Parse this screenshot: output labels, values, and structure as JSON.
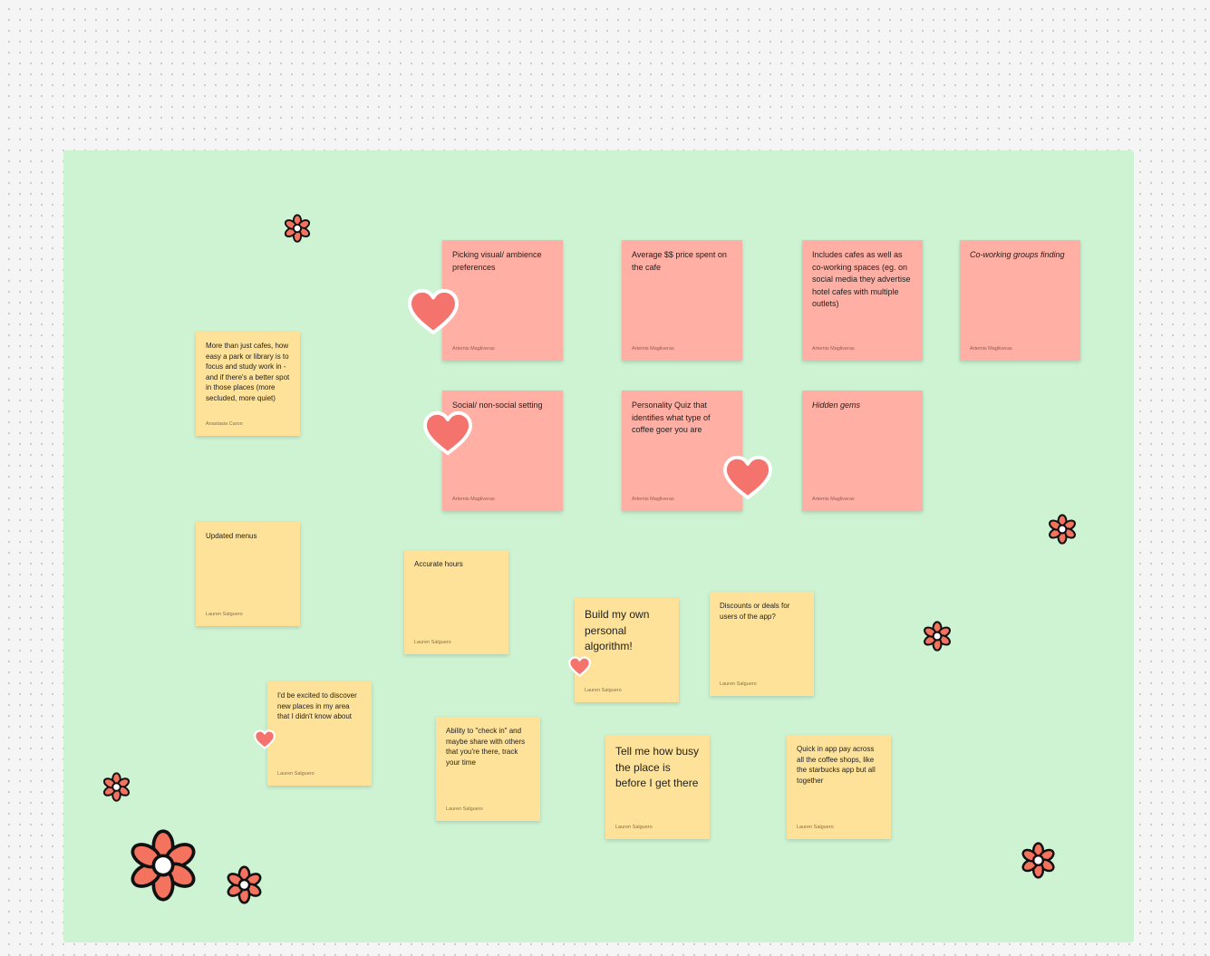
{
  "notes": [
    {
      "text": "Picking visual/ ambience preferences",
      "author": "Artemis Magliveras"
    },
    {
      "text": "Average $$ price spent on the cafe",
      "author": "Artemis Magliveras"
    },
    {
      "text": "Includes cafes as well as co-working spaces (eg. on social media they advertise hotel cafes with multiple outlets)",
      "author": "Artemis Magliveras"
    },
    {
      "text": "Co-working groups finding",
      "author": "Artemis Magliveras"
    },
    {
      "text": "Social/ non-social setting",
      "author": "Artemis Magliveras"
    },
    {
      "text": "Personality Quiz that identifies what type of coffee goer you are",
      "author": "Artemis Magliveras"
    },
    {
      "text": "Hidden gems",
      "author": "Artemis Magliveras"
    },
    {
      "text": "More than just cafes, how easy a park or library is to focus and study work in - and if there's a better spot in those places (more secluded, more quiet)",
      "author": "Anastasia Caron"
    },
    {
      "text": "Updated menus",
      "author": "Lauren Salguero"
    },
    {
      "text": "Accurate hours",
      "author": "Lauren Salguero"
    },
    {
      "text": "Build my own personal algorithm!",
      "author": "Lauren Salguero"
    },
    {
      "text": "Discounts or deals for users of the app?",
      "author": "Lauren Salguero"
    },
    {
      "text": "I'd be excited to discover new places in my area that I didn't know about",
      "author": "Lauren Salguero"
    },
    {
      "text": "Ability to \"check in\" and maybe share with others that you're there, track your time",
      "author": "Lauren Salguero"
    },
    {
      "text": "Tell me how busy the place is before I get there",
      "author": "Lauren Salguero"
    },
    {
      "text": "Quick in app pay across all the coffee shops, like the starbucks app but all together",
      "author": "Lauren Salguero"
    }
  ],
  "colors": {
    "board": "#cdf3d3",
    "pink_note": "#ffafa3",
    "yellow_note": "#ffe299",
    "heart": "#f4736c",
    "flower": "#f4735e"
  },
  "stickers": {
    "hearts": [
      "heart-icon",
      "heart-icon",
      "heart-icon",
      "heart-icon",
      "heart-icon"
    ],
    "flowers": [
      "flower-icon",
      "flower-icon",
      "flower-icon",
      "flower-icon",
      "flower-icon",
      "flower-icon",
      "flower-icon"
    ]
  }
}
